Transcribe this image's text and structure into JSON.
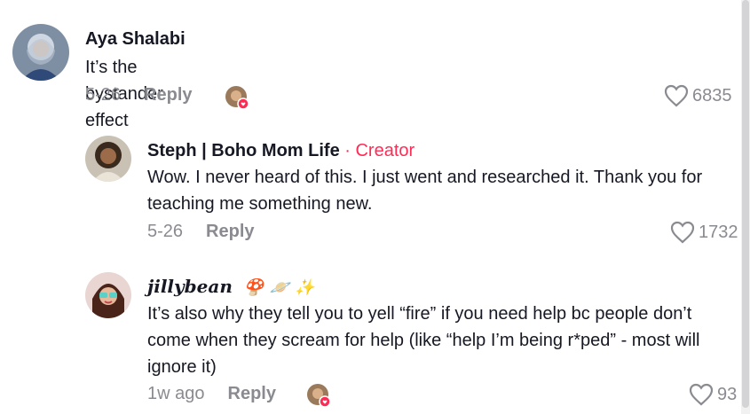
{
  "comments": [
    {
      "name": "Aya Shalabi",
      "text": "It’s the bystander effect",
      "date": "5-26",
      "reply": "Reply",
      "likes": "6835"
    },
    {
      "name": "Steph | Boho Mom Life",
      "creator_tag": "· Creator",
      "text": "Wow. I never heard of this. I just went and researched it. Thank you for teaching me something new.",
      "date": "5-26",
      "reply": "Reply",
      "likes": "1732"
    },
    {
      "name": "jillybean",
      "emojis": "🍄 🪐 ✨",
      "text": "It’s also why they tell you to yell “fire” if you need help bc people don’t come when they scream for help (like “help I’m being r*ped” - most will ignore it)",
      "date": "1w ago",
      "reply": "Reply",
      "likes": "93"
    }
  ],
  "colors": {
    "creator": "#fe2c55",
    "muted": "#8a8b91",
    "text": "#161823"
  }
}
